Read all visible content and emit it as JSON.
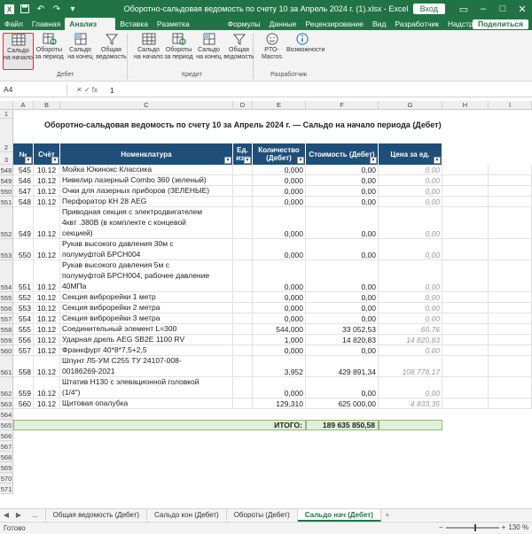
{
  "titlebar": {
    "title": "Оборотно-сальдовая ведомость по счету 10 за Апрель 2024 г. (1).xlsx  -  Excel",
    "signin": "Вход"
  },
  "menu": {
    "tabs": [
      "Файл",
      "Главная",
      "Анализ ОСВ",
      "Вставка",
      "Разметка страницы",
      "Формулы",
      "Данные",
      "Рецензирование",
      "Вид",
      "Разработчик",
      "Надстройки",
      "Справка"
    ],
    "active": "Анализ ОСВ",
    "share": "Поделиться"
  },
  "ribbon": {
    "debet_buttons": [
      {
        "line1": "Сальдо",
        "line2": "на начало"
      },
      {
        "line1": "Обороты",
        "line2": "за период"
      },
      {
        "line1": "Сальдо",
        "line2": "на конец"
      },
      {
        "line1": "Общая",
        "line2": "ведомость"
      }
    ],
    "debet_group": "Дебет",
    "kredit_buttons": [
      {
        "line1": "Сальдо",
        "line2": "на начало"
      },
      {
        "line1": "Обороты",
        "line2": "за период"
      },
      {
        "line1": "Сальдо",
        "line2": "на конец"
      },
      {
        "line1": "Общая",
        "line2": "ведомость"
      }
    ],
    "kredit_group": "Кредит",
    "dev_buttons": [
      {
        "line1": "PTO-",
        "line2": "Macros"
      },
      {
        "line1": "Возможности",
        "line2": ""
      }
    ],
    "dev_group": "Разработчик"
  },
  "formula": {
    "namebox": "A4",
    "value": "1"
  },
  "sheet": {
    "columns": [
      "A",
      "B",
      "C",
      "D",
      "E",
      "F",
      "G",
      "H",
      "I"
    ],
    "title": "Оборотно-сальдовая ведомость по счету 10 за Апрель 2024 г. — Сальдо на начало периода (Дебет)",
    "headers": {
      "num": "№",
      "schet": "Счёт",
      "nom": "Номенклатура",
      "ed1": "Ед.",
      "ed2": "изм",
      "kol1": "Количество",
      "kol2": "(Дебет)",
      "st": "Стоимость (Дебет)",
      "price": "Цена за ед."
    },
    "top_rows": [
      "1",
      "2",
      "3"
    ],
    "rows": [
      {
        "rn": "548",
        "n": "545",
        "s": "10.12",
        "name": [
          "Мойка Юкинокс Классика"
        ],
        "kol": "0,000",
        "st": "0,00",
        "p": "0,00"
      },
      {
        "rn": "549",
        "n": "546",
        "s": "10.12",
        "name": [
          "Нивелир лазерный Combo 360 (зеленый)"
        ],
        "kol": "0,000",
        "st": "0,00",
        "p": "0,00"
      },
      {
        "rn": "550",
        "n": "547",
        "s": "10.12",
        "name": [
          "Очки для лазерных приборов (ЗЕЛЕНЫЕ)"
        ],
        "kol": "0,000",
        "st": "0,00",
        "p": "0,00"
      },
      {
        "rn": "551",
        "n": "548",
        "s": "10.12",
        "name": [
          "Перфоратор КН 28 AEG"
        ],
        "kol": "0,000",
        "st": "0,00",
        "p": "0,00"
      },
      {
        "rn": "552",
        "n": "549",
        "s": "10.12",
        "name": [
          "Приводная секция с электродвигателем",
          "4квт .380В (в комплекте с концевой",
          "секцией)"
        ],
        "kol": "0,000",
        "st": "0,00",
        "p": "0,00"
      },
      {
        "rn": "553",
        "n": "550",
        "s": "10.12",
        "name": [
          "Рукав высокого давления 30м с",
          "полумуфтой БРСН004"
        ],
        "kol": "0,000",
        "st": "0,00",
        "p": "0,00"
      },
      {
        "rn": "554",
        "n": "551",
        "s": "10.12",
        "name": [
          "Рукав высокого давления 5м с",
          "полумуфтой БРСН004, рабочее давление",
          "40МПа"
        ],
        "kol": "0,000",
        "st": "0,00",
        "p": "0,00"
      },
      {
        "rn": "555",
        "n": "552",
        "s": "10.12",
        "name": [
          "Секция виброрейки 1 метр"
        ],
        "kol": "0,000",
        "st": "0,00",
        "p": "0,00"
      },
      {
        "rn": "556",
        "n": "553",
        "s": "10.12",
        "name": [
          "Секция виброрейки 2 метра"
        ],
        "kol": "0,000",
        "st": "0,00",
        "p": "0,00"
      },
      {
        "rn": "557",
        "n": "554",
        "s": "10.12",
        "name": [
          "Секция виброрейки 3 метра"
        ],
        "kol": "0,000",
        "st": "0,00",
        "p": "0,00"
      },
      {
        "rn": "558",
        "n": "555",
        "s": "10.12",
        "name": [
          "Соединительный элемент L=300"
        ],
        "kol": "544,000",
        "st": "33 052,53",
        "p": "60,76"
      },
      {
        "rn": "559",
        "n": "556",
        "s": "10.12",
        "name": [
          "Ударная дрель AEG SB2E  1100 RV"
        ],
        "kol": "1,000",
        "st": "14 820,83",
        "p": "14 820,83"
      },
      {
        "rn": "560",
        "n": "557",
        "s": "10.12",
        "name": [
          "Франкфурт 40*8*7,5+2,5"
        ],
        "kol": "0,000",
        "st": "0,00",
        "p": "0,00"
      },
      {
        "rn": "561",
        "n": "558",
        "s": "10.12",
        "name": [
          "Шпунт Л5-УМ С255 ТУ 24107-008-",
          "00186269-2021"
        ],
        "kol": "3,952",
        "st": "429 891,34",
        "p": "108 778,17"
      },
      {
        "rn": "562",
        "n": "559",
        "s": "10.12",
        "name": [
          "Штатив Н130 с элевационной головкой",
          "(1/4\")"
        ],
        "kol": "0,000",
        "st": "0,00",
        "p": "0,00"
      },
      {
        "rn": "563",
        "n": "560",
        "s": "10.12",
        "name": [
          "Щитовая опалубка"
        ],
        "kol": "129,310",
        "st": "625 000,00",
        "p": "4 833,35"
      }
    ],
    "blank_rows_before": [
      "564"
    ],
    "total": {
      "rn": "565",
      "label": "ИТОГО:",
      "value": "189 635 850,58"
    },
    "blank_rows_after": [
      "566",
      "567",
      "568",
      "569",
      "570",
      "571"
    ]
  },
  "sheet_tabs": {
    "ellipsis": "...",
    "tabs": [
      "Общая ведомость (Дебет)",
      "Сальдо кон (Дебет)",
      "Обороты (Дебет)",
      "Сальдо нач (Дебет)"
    ],
    "active": "Сальдо нач (Дебет)",
    "add": "+"
  },
  "status": {
    "ready": "Готово",
    "zoom": "130 %"
  },
  "colors": {
    "brand": "#217346",
    "header_fill": "#1f4e78",
    "total_fill": "#e2efda",
    "highlight": "#e03030"
  }
}
